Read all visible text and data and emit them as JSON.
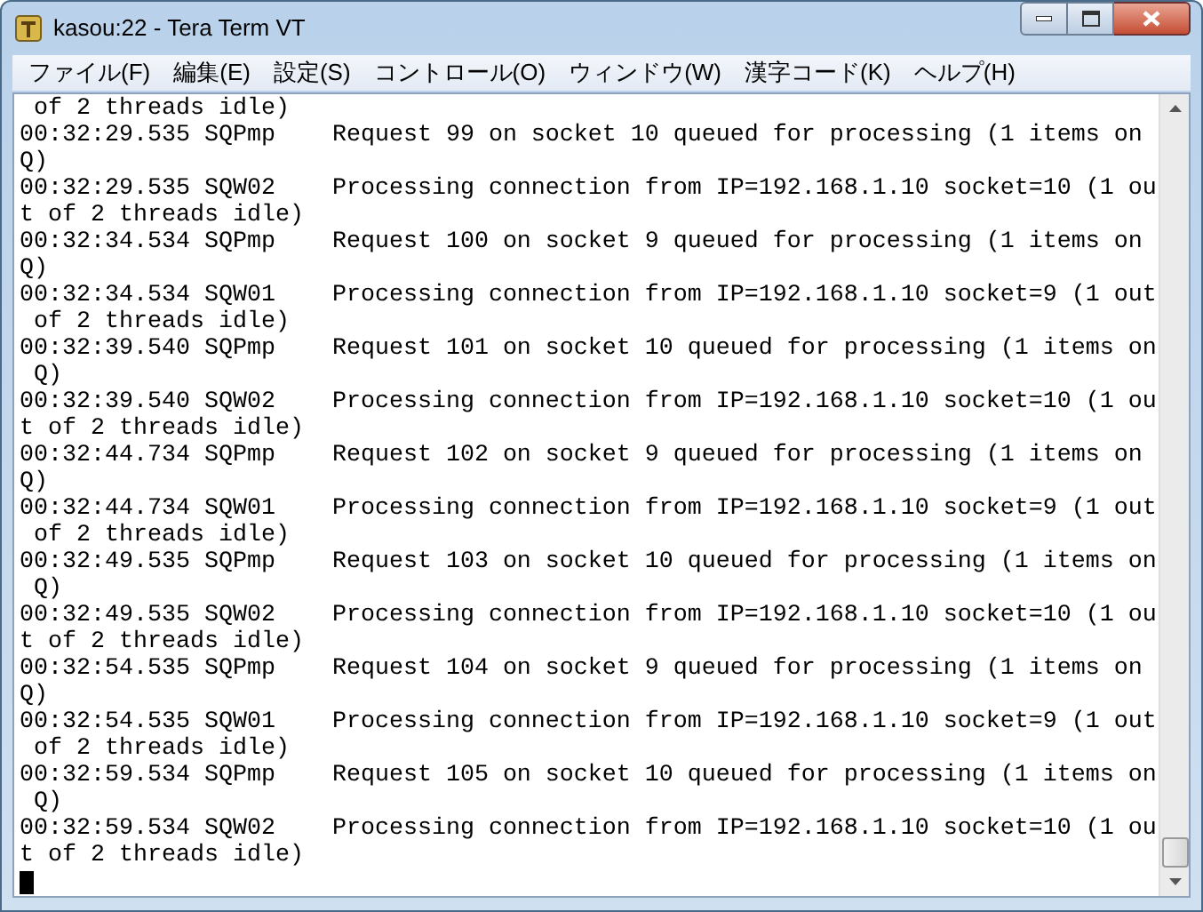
{
  "window": {
    "title": "kasou:22 - Tera Term VT"
  },
  "menu": [
    "ファイル(F)",
    "編集(E)",
    "設定(S)",
    "コントロール(O)",
    "ウィンドウ(W)",
    "漢字コード(K)",
    "ヘルプ(H)"
  ],
  "terminal": {
    "lines": [
      " of 2 threads idle)",
      "00:32:29.535 SQPmp    Request 99 on socket 10 queued for processing (1 items on",
      "Q)",
      "00:32:29.535 SQW02    Processing connection from IP=192.168.1.10 socket=10 (1 ou",
      "t of 2 threads idle)",
      "00:32:34.534 SQPmp    Request 100 on socket 9 queued for processing (1 items on",
      "Q)",
      "00:32:34.534 SQW01    Processing connection from IP=192.168.1.10 socket=9 (1 out",
      " of 2 threads idle)",
      "00:32:39.540 SQPmp    Request 101 on socket 10 queued for processing (1 items on",
      " Q)",
      "00:32:39.540 SQW02    Processing connection from IP=192.168.1.10 socket=10 (1 ou",
      "t of 2 threads idle)",
      "00:32:44.734 SQPmp    Request 102 on socket 9 queued for processing (1 items on",
      "Q)",
      "00:32:44.734 SQW01    Processing connection from IP=192.168.1.10 socket=9 (1 out",
      " of 2 threads idle)",
      "00:32:49.535 SQPmp    Request 103 on socket 10 queued for processing (1 items on",
      " Q)",
      "00:32:49.535 SQW02    Processing connection from IP=192.168.1.10 socket=10 (1 ou",
      "t of 2 threads idle)",
      "00:32:54.535 SQPmp    Request 104 on socket 9 queued for processing (1 items on",
      "Q)",
      "00:32:54.535 SQW01    Processing connection from IP=192.168.1.10 socket=9 (1 out",
      " of 2 threads idle)",
      "00:32:59.534 SQPmp    Request 105 on socket 10 queued for processing (1 items on",
      " Q)",
      "00:32:59.534 SQW02    Processing connection from IP=192.168.1.10 socket=10 (1 ou",
      "t of 2 threads idle)"
    ]
  }
}
